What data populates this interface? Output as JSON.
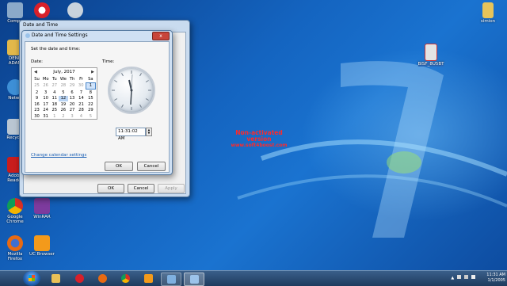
{
  "desktop": {
    "icons": [
      {
        "id": "computer",
        "label": "Compu",
        "color": "#8aa9c9"
      },
      {
        "id": "opera",
        "label": "",
        "color": "#d8202a"
      },
      {
        "id": "network2",
        "label": "",
        "color": "#c9d3dd"
      },
      {
        "id": "denn",
        "label": "DENN ADAM",
        "color": "#e2b84a"
      },
      {
        "id": "network",
        "label": "Netwo",
        "color": "#3d8fd6"
      },
      {
        "id": "recycle",
        "label": "Recycle",
        "color": "#b9c6d2"
      },
      {
        "id": "adobe",
        "label": "Adobe Reader",
        "color": "#c91d1d"
      },
      {
        "id": "chrome",
        "label": "Google Chrome",
        "color": "#2fa14f"
      },
      {
        "id": "winrar",
        "label": "WinRAR",
        "color": "#7d3b9e"
      },
      {
        "id": "firefox",
        "label": "Mozilla Firefox",
        "color": "#e86a12"
      },
      {
        "id": "ucbrowser",
        "label": "UC Browser",
        "color": "#f39a1b"
      },
      {
        "id": "simion",
        "label": "simion",
        "color": "#e6c45a"
      },
      {
        "id": "file",
        "label": "BISF_8U5BT",
        "color": "#e4e4e4"
      }
    ],
    "watermark": {
      "line1": "Non-activated",
      "line2": "version",
      "line3": "www.soft4boost.com"
    }
  },
  "back_window": {
    "title": "Date and Time",
    "ok_label": "OK",
    "cancel_label": "Cancel",
    "apply_label": "Apply"
  },
  "dialog": {
    "title": "Date and Time Settings",
    "close_label": "x",
    "instruction": "Set the date and time:",
    "date_label": "Date:",
    "time_label": "Time:",
    "month_label": "July, 2017",
    "weekdays": [
      "Su",
      "Mo",
      "Tu",
      "We",
      "Th",
      "Fr",
      "Sa"
    ],
    "weeks": [
      [
        "25",
        "26",
        "27",
        "28",
        "29",
        "30",
        "1"
      ],
      [
        "2",
        "3",
        "4",
        "5",
        "6",
        "7",
        "8"
      ],
      [
        "9",
        "10",
        "11",
        "12",
        "13",
        "14",
        "15"
      ],
      [
        "16",
        "17",
        "18",
        "19",
        "20",
        "21",
        "22"
      ],
      [
        "23",
        "24",
        "25",
        "26",
        "27",
        "28",
        "29"
      ],
      [
        "30",
        "31",
        "1",
        "2",
        "3",
        "4",
        "5"
      ]
    ],
    "time_value": "11:31:02 AM",
    "change_calendar_link": "Change calendar settings",
    "ok_label": "OK",
    "cancel_label": "Cancel"
  },
  "taskbar": {
    "clock_time": "11:31 AM",
    "clock_date": "1/1/2005",
    "pinned": [
      {
        "id": "explorer",
        "color": "#e9c157"
      },
      {
        "id": "opera",
        "color": "#d8202a"
      },
      {
        "id": "firefox",
        "color": "#e86a12"
      },
      {
        "id": "chrome",
        "color": "#2fa14f"
      },
      {
        "id": "ucbrowser",
        "color": "#f39a1b"
      },
      {
        "id": "control-panel",
        "color": "#7fb0e0"
      },
      {
        "id": "date-time",
        "color": "#9cc3ea"
      }
    ]
  }
}
